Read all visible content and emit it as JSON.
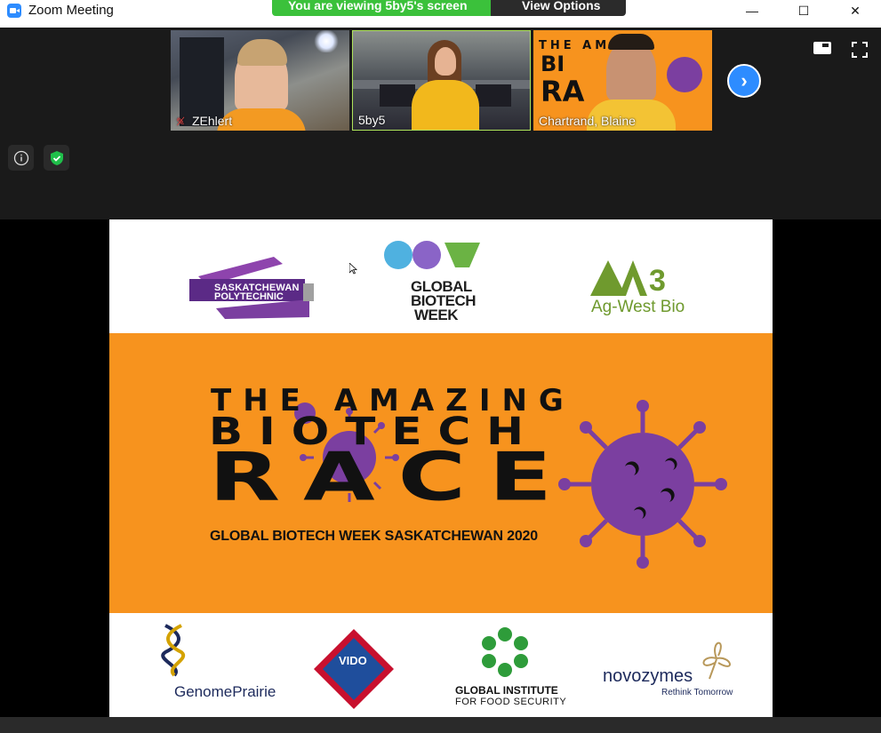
{
  "window": {
    "title": "Zoom Meeting",
    "controls": {
      "minimize": "—",
      "maximize": "☐",
      "close": "✕"
    }
  },
  "banner": {
    "viewing_text": "You are viewing 5by5's screen",
    "view_options_label": "View Options"
  },
  "participants": [
    {
      "name": "ZEhlert",
      "muted": true
    },
    {
      "name": "5by5",
      "muted": false,
      "active_speaker": true
    },
    {
      "name": "Chartrand, Blaine",
      "muted": false
    }
  ],
  "slide": {
    "top_logos": {
      "sask_poly_line1": "SASKATCHEWAN",
      "sask_poly_line2": "POLYTECHNIC",
      "gbw_line1": "GLOBAL",
      "gbw_line2": "BIOTECH",
      "gbw_line3": "WEEK",
      "agwest": "Ag-West Bio"
    },
    "headline": {
      "line1": "THE AMAZING",
      "line2": "BIOTECH",
      "line3": "RACE",
      "subtitle": "GLOBAL BIOTECH WEEK SASKATCHEWAN 2020"
    },
    "bottom_logos": {
      "genome": "GenomePrairie",
      "gifs_line1": "GLOBAL INSTITUTE",
      "gifs_line2": "FOR FOOD SECURITY",
      "novozymes": "novozymes",
      "novozymes_tag": "Rethink Tomorrow",
      "vido": "VIDO"
    }
  },
  "colors": {
    "banner_green": "#3bc13b",
    "zoom_blue": "#2d8cff",
    "slide_orange": "#f7931e",
    "virus_purple": "#7b3fa0",
    "shield_green": "#1fbf4a"
  }
}
